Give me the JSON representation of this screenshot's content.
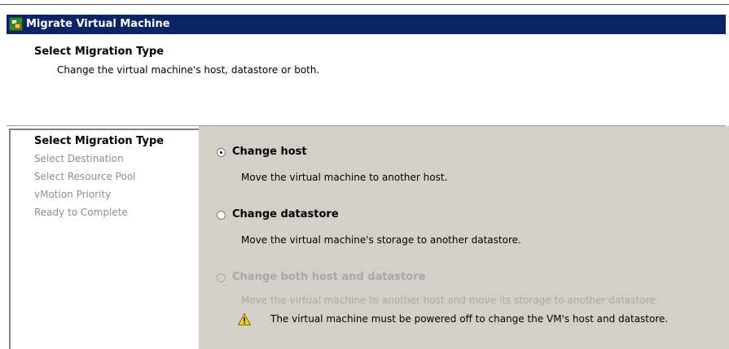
{
  "window": {
    "title": "Migrate Virtual Machine",
    "icon": "vm-migrate-icon"
  },
  "header": {
    "title": "Select Migration Type",
    "subtitle": "Change the virtual machine's host, datastore or both."
  },
  "steps": [
    {
      "label": "Select Migration Type",
      "active": true
    },
    {
      "label": "Select Destination",
      "active": false
    },
    {
      "label": "Select Resource Pool",
      "active": false
    },
    {
      "label": "vMotion Priority",
      "active": false
    },
    {
      "label": "Ready to Complete",
      "active": false
    }
  ],
  "options": [
    {
      "label": "Change host",
      "description": "Move the virtual machine to another host.",
      "checked": true,
      "enabled": true
    },
    {
      "label": "Change datastore",
      "description": "Move the virtual machine's storage to another datastore.",
      "checked": false,
      "enabled": true
    },
    {
      "label": "Change both host and datastore",
      "description": "Move the virtual machine to another host and move its storage to another datastore.",
      "checked": false,
      "enabled": false
    }
  ],
  "warning": {
    "icon": "warning-icon",
    "text": "The virtual machine must be powered off to change the VM's host and datastore."
  },
  "colors": {
    "titlebar": "#0a2466",
    "panel_background": "#d4d0c8",
    "disabled_text": "#a8a8a8"
  }
}
